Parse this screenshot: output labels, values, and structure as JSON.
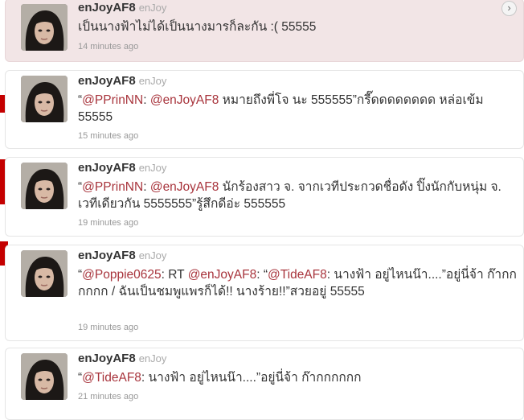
{
  "colors": {
    "highlight_bg": "#f2e5e6",
    "mention": "#a8343c",
    "meta": "#999999",
    "accent_red": "#c40000"
  },
  "tweets": [
    {
      "screen_name": "enJoyAF8",
      "full_name": "enJoy",
      "segments": [
        {
          "text": "เป็นนางฟ้าไม่ได้เป็นนางมารก็ละกัน :( 55555",
          "mention": false
        }
      ],
      "time": "14 minutes ago",
      "highlighted": true,
      "expand_icon": "chevron-right-icon"
    },
    {
      "screen_name": "enJoyAF8",
      "full_name": "enJoy",
      "segments": [
        {
          "text": "“",
          "mention": false
        },
        {
          "text": "@PPrinNN",
          "mention": true
        },
        {
          "text": ": ",
          "mention": false
        },
        {
          "text": "@enJoyAF8",
          "mention": true
        },
        {
          "text": " หมายถึงพี่โจ นะ 555555”กรี๊ดดดดดดดด หล่อเข้ม 55555",
          "mention": false
        }
      ],
      "time": "15 minutes ago",
      "highlighted": false
    },
    {
      "screen_name": "enJoyAF8",
      "full_name": "enJoy",
      "segments": [
        {
          "text": "“",
          "mention": false
        },
        {
          "text": "@PPrinNN",
          "mention": true
        },
        {
          "text": ": ",
          "mention": false
        },
        {
          "text": "@enJoyAF8",
          "mention": true
        },
        {
          "text": " นักร้องสาว จ. จากเวทีประกวดชื่อดัง ปิ๊งนักกับหนุ่ม จ. เวทีเดียวกัน 5555555”รู้สึกดีอ่ะ 555555",
          "mention": false
        }
      ],
      "time": "19 minutes ago",
      "highlighted": false
    },
    {
      "screen_name": "enJoyAF8",
      "full_name": "enJoy",
      "segments": [
        {
          "text": "“",
          "mention": false
        },
        {
          "text": "@Poppie0625",
          "mention": true
        },
        {
          "text": ": RT ",
          "mention": false
        },
        {
          "text": "@enJoyAF8",
          "mention": true
        },
        {
          "text": ": “",
          "mention": false
        },
        {
          "text": "@TideAF8",
          "mention": true
        },
        {
          "text": ": นางฟ้า อยู่ไหนน๊า....”อยู่นี่จ้า ก๊ากกกกกก / ฉันเป็นชมพูแพรก็ได้!! นางร้าย!!”สวยอยู่ 55555",
          "mention": false
        }
      ],
      "time": "19 minutes ago",
      "highlighted": false
    },
    {
      "screen_name": "enJoyAF8",
      "full_name": "enJoy",
      "segments": [
        {
          "text": "“",
          "mention": false
        },
        {
          "text": "@TideAF8",
          "mention": true
        },
        {
          "text": ": นางฟ้า อยู่ไหนน๊า....”อยู่นี่จ้า ก๊ากกกกกก",
          "mention": false
        }
      ],
      "time": "21 minutes ago",
      "highlighted": false
    }
  ]
}
